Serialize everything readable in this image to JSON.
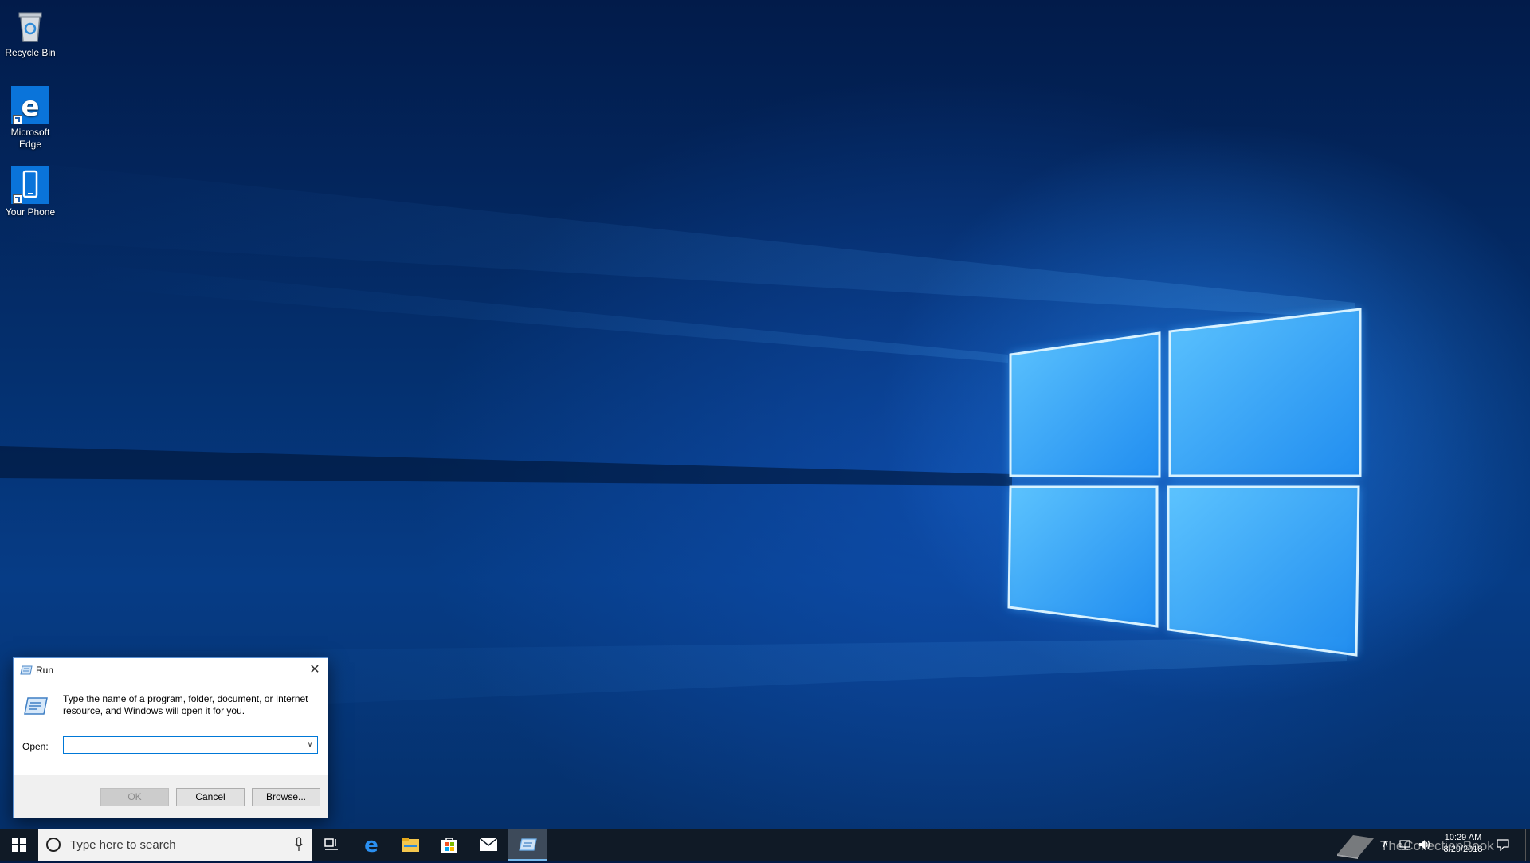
{
  "desktop": {
    "icons": [
      {
        "label": "Recycle Bin",
        "icon": "recycle-bin-icon"
      },
      {
        "label": "Microsoft Edge",
        "icon": "edge-icon"
      },
      {
        "label": "Your Phone",
        "icon": "phone-icon"
      }
    ]
  },
  "run_dialog": {
    "title": "Run",
    "description": "Type the name of a program, folder, document, or Internet resource, and Windows will open it for you.",
    "open_label": "Open:",
    "open_value": "",
    "buttons": {
      "ok": "OK",
      "cancel": "Cancel",
      "browse": "Browse..."
    }
  },
  "taskbar": {
    "search_placeholder": "Type here to search",
    "pinned": [
      "task-view-icon",
      "edge-icon",
      "file-explorer-icon",
      "store-icon",
      "mail-icon",
      "run-icon"
    ],
    "active_app": "run-icon",
    "tray": {
      "watermark": "TheCollectionBook",
      "time": "10:29 AM",
      "date": "8/29/2018"
    }
  },
  "colors": {
    "accent": "#0078d7",
    "taskbar": "#101a26",
    "edge_blue": "#0a74da",
    "wallpaper": "#063c86"
  }
}
